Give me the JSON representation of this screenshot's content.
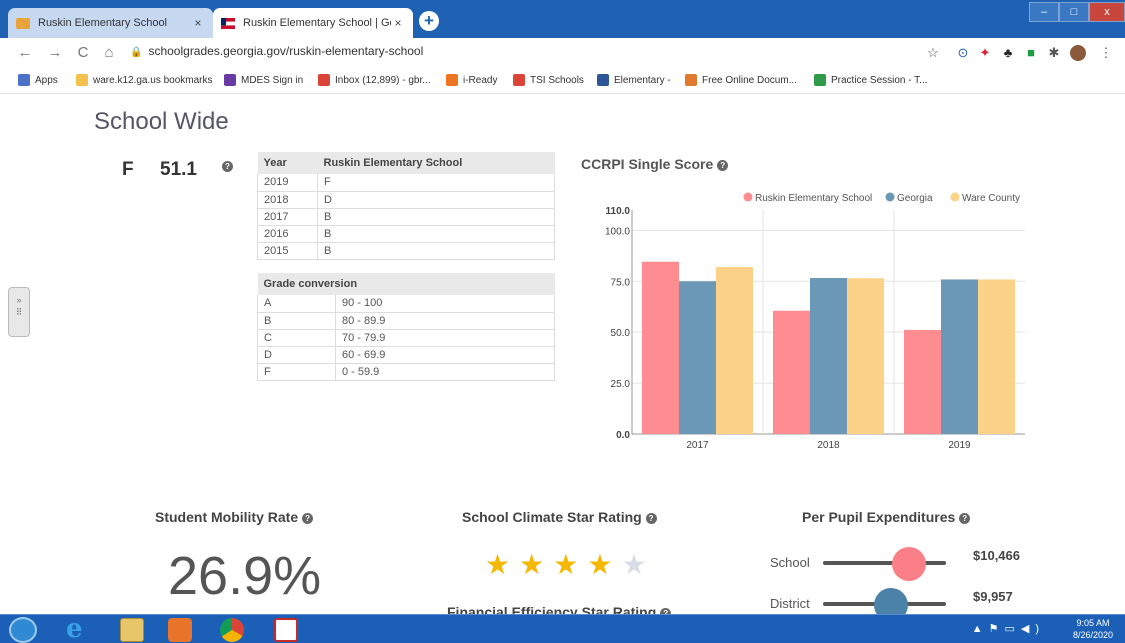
{
  "browser": {
    "tabs": [
      {
        "title": "Ruskin Elementary School",
        "close": "×"
      },
      {
        "title": "Ruskin Elementary School | Georg",
        "close": "×"
      }
    ],
    "new_tab": "+",
    "window_buttons": {
      "minimize": "–",
      "maximize": "□",
      "close": "x"
    },
    "url": "schoolgrades.georgia.gov/ruskin-elementary-school",
    "bookmarks": [
      {
        "label": "Apps",
        "color": "#4b72c8"
      },
      {
        "label": "ware.k12.ga.us bookmarks",
        "color": "#f2c24c"
      },
      {
        "label": "MDES Sign in",
        "color": "#6a3ca3"
      },
      {
        "label": "Inbox (12,899) - gbr...",
        "color": "#db4437"
      },
      {
        "label": "i-Ready",
        "color": "#ee7623"
      },
      {
        "label": "TSI Schools",
        "color": "#db4437"
      },
      {
        "label": "Elementary -",
        "color": "#2b5797"
      },
      {
        "label": "Free Online Docum...",
        "color": "#e07b2e"
      },
      {
        "label": "Practice Session - T...",
        "color": "#2e9a4a"
      }
    ]
  },
  "page": {
    "title": "School Wide",
    "grade": {
      "letter": "F",
      "score": "51.1",
      "help": "?"
    },
    "year_table": {
      "headers": [
        "Year",
        "Ruskin Elementary School"
      ],
      "rows": [
        [
          "2019",
          "F"
        ],
        [
          "2018",
          "D"
        ],
        [
          "2017",
          "B"
        ],
        [
          "2016",
          "B"
        ],
        [
          "2015",
          "B"
        ]
      ]
    },
    "conversion_table": {
      "header": "Grade conversion",
      "rows": [
        [
          "A",
          "90 - 100"
        ],
        [
          "B",
          "80 - 89.9"
        ],
        [
          "C",
          "70 - 79.9"
        ],
        [
          "D",
          "60 - 69.9"
        ],
        [
          "F",
          "0 - 59.9"
        ]
      ]
    },
    "side_handle": "»",
    "ccrpi_title": "CCRPI Single Score",
    "mobility": {
      "title": "Student Mobility Rate",
      "value": "26.9%"
    },
    "climate": {
      "title": "School Climate Star Rating",
      "rating": 4,
      "max": 5,
      "star_glyph": "★",
      "filled_color": "#f5b800",
      "empty_color": "#d8dde6"
    },
    "financial": {
      "title": "Financial Efficiency Star Rating"
    },
    "expenditures": {
      "title": "Per Pupil Expenditures",
      "rows": [
        {
          "label": "School",
          "value": "$10,466",
          "color": "#fb7f86",
          "level": 0.7
        },
        {
          "label": "District",
          "value": "$9,957",
          "color": "#4b82a8",
          "level": 0.55
        }
      ]
    }
  },
  "taskbar": {
    "apps": [
      "Internet Explorer",
      "File Explorer",
      "Media",
      "Chrome",
      "Acrobat"
    ],
    "clock_time": "9:05 AM",
    "clock_date": "8/26/2020"
  },
  "chart_data": {
    "type": "bar",
    "title": "CCRPI Single Score",
    "categories": [
      "2017",
      "2018",
      "2019"
    ],
    "series": [
      {
        "name": "Ruskin Elementary School",
        "color": "#fe8c90",
        "values": [
          84.6,
          60.5,
          51.1
        ]
      },
      {
        "name": "Georgia",
        "color": "#6b98b6",
        "values": [
          75.0,
          76.6,
          75.9
        ]
      },
      {
        "name": "Ware County",
        "color": "#fbd287",
        "values": [
          82.0,
          76.5,
          75.9
        ]
      }
    ],
    "yticks": [
      "0.0",
      "25.0",
      "50.0",
      "75.0",
      "100.0",
      "110.0"
    ],
    "ylim": [
      0,
      110
    ],
    "grid": true,
    "legend": "top-right"
  }
}
